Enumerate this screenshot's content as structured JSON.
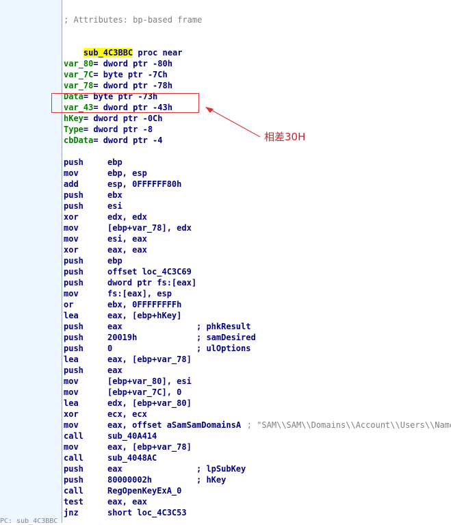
{
  "comment": "; Attributes: bp-based frame",
  "proc": {
    "name": "sub_4C3BBC",
    "rest": "proc near"
  },
  "vars": [
    {
      "name": "var_80",
      "def": "= dword ptr -80h"
    },
    {
      "name": "var_7C",
      "def": "= byte ptr -7Ch"
    },
    {
      "name": "var_78",
      "def": "= dword ptr -78h"
    },
    {
      "name": "Data",
      "def": "= byte ptr -73h"
    },
    {
      "name": "var_43",
      "def": "= dword ptr -43h"
    },
    {
      "name": "hKey",
      "def": "= dword ptr -0Ch"
    },
    {
      "name": "Type",
      "def": "= dword ptr -8"
    },
    {
      "name": "cbData",
      "def": "= dword ptr -4"
    }
  ],
  "instructions": [
    {
      "m": "push",
      "o": "ebp",
      "c": ""
    },
    {
      "m": "mov",
      "o": "ebp, esp",
      "c": ""
    },
    {
      "m": "add",
      "o": "esp, 0FFFFFF80h",
      "c": ""
    },
    {
      "m": "push",
      "o": "ebx",
      "c": ""
    },
    {
      "m": "push",
      "o": "esi",
      "c": ""
    },
    {
      "m": "xor",
      "o": "edx, edx",
      "c": ""
    },
    {
      "m": "mov",
      "o": "[ebp+var_78], edx",
      "c": ""
    },
    {
      "m": "mov",
      "o": "esi, eax",
      "c": ""
    },
    {
      "m": "xor",
      "o": "eax, eax",
      "c": ""
    },
    {
      "m": "push",
      "o": "ebp",
      "c": ""
    },
    {
      "m": "push",
      "o": "offset loc_4C3C69",
      "c": ""
    },
    {
      "m": "push",
      "o": "dword ptr fs:[eax]",
      "c": ""
    },
    {
      "m": "mov",
      "o": "fs:[eax], esp",
      "c": ""
    },
    {
      "m": "or",
      "o": "ebx, 0FFFFFFFFh",
      "c": ""
    },
    {
      "m": "lea",
      "o": "eax, [ebp+hKey]",
      "c": ""
    },
    {
      "m": "push",
      "o": "eax",
      "c": "; phkResult"
    },
    {
      "m": "push",
      "o": "20019h",
      "c": "; samDesired"
    },
    {
      "m": "push",
      "o": "0",
      "c": "; ulOptions"
    },
    {
      "m": "lea",
      "o": "eax, [ebp+var_78]",
      "c": ""
    },
    {
      "m": "push",
      "o": "eax",
      "c": ""
    },
    {
      "m": "mov",
      "o": "[ebp+var_80], esi",
      "c": ""
    },
    {
      "m": "mov",
      "o": "[ebp+var_7C], 0",
      "c": ""
    },
    {
      "m": "lea",
      "o": "edx, [ebp+var_80]",
      "c": ""
    },
    {
      "m": "xor",
      "o": "ecx, ecx",
      "c": ""
    },
    {
      "m": "mov",
      "o": "eax, offset aSamSamDomainsA",
      "c": "; \"SAM\\\\SAM\\\\Domains\\\\Account\\\\Users\\\\Names\""
    },
    {
      "m": "call",
      "o": "sub_40A414",
      "c": ""
    },
    {
      "m": "mov",
      "o": "eax, [ebp+var_78]",
      "c": ""
    },
    {
      "m": "call",
      "o": "sub_4048AC",
      "c": ""
    },
    {
      "m": "push",
      "o": "eax",
      "c": "; lpSubKey"
    },
    {
      "m": "push",
      "o": "80000002h",
      "c": "; hKey"
    },
    {
      "m": "call",
      "o": "RegOpenKeyExA_0",
      "c": ""
    },
    {
      "m": "test",
      "o": "eax, eax",
      "c": ""
    },
    {
      "m": "jnz",
      "o": "short loc_4C3C53",
      "c": ""
    }
  ],
  "annotation": "相差30H",
  "status_text": "PC: sub_4C3BBC",
  "colors": {
    "highlight": "#ffff00",
    "annotation": "#d02020",
    "label": "#000080",
    "number": "#008000"
  }
}
